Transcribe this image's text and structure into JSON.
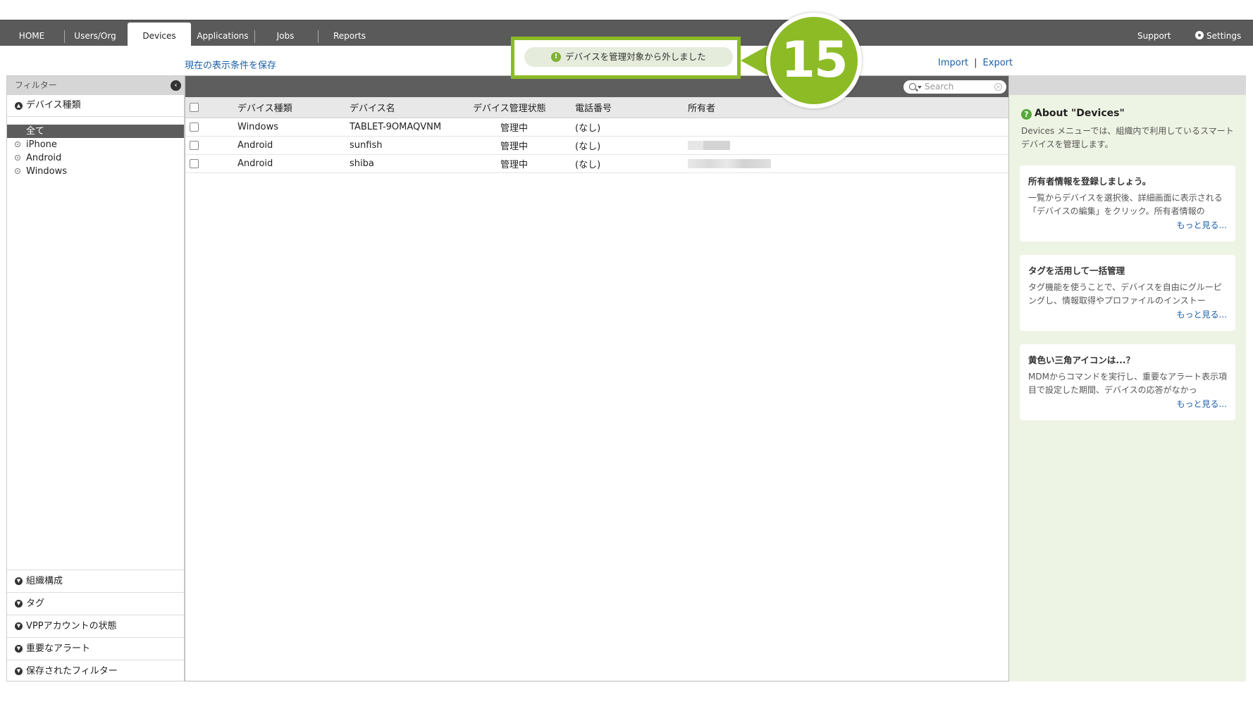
{
  "nav": {
    "tabs": [
      "HOME",
      "Users/Org",
      "Devices",
      "Applications",
      "Jobs",
      "Reports"
    ],
    "active_tab": "Devices",
    "support": "Support",
    "settings": "Settings"
  },
  "toolbar": {
    "save_view": "現在の表示条件を保存",
    "import": "Import",
    "separator": "|",
    "export": "Export"
  },
  "notification": {
    "message": "デバイスを管理対象から外しました",
    "callout_number": "15",
    "accent_color": "#8cbb26"
  },
  "filter": {
    "title": "フィルター",
    "device_type_header": "デバイス種類",
    "items": [
      "全て",
      "iPhone",
      "Android",
      "Windows"
    ],
    "selected": "全て",
    "sections": [
      "組織構成",
      "タグ",
      "VPPアカウントの状態",
      "重要なアラート",
      "保存されたフィルター"
    ]
  },
  "search": {
    "placeholder": "Search"
  },
  "table": {
    "columns": [
      "デバイス種類",
      "デバイス名",
      "デバイス管理状態",
      "電話番号",
      "所有者"
    ],
    "rows": [
      {
        "type": "Windows",
        "name": "TABLET-9OMAQVNM",
        "status": "管理中",
        "phone": "(なし)",
        "owner": ""
      },
      {
        "type": "Android",
        "name": "sunfish",
        "status": "管理中",
        "phone": "(なし)",
        "owner": ""
      },
      {
        "type": "Android",
        "name": "shiba",
        "status": "管理中",
        "phone": "(なし)",
        "owner": ""
      }
    ]
  },
  "info": {
    "title": "About \"Devices\"",
    "description": "Devices メニューでは、組織内で利用しているスマートデバイスを管理します。",
    "tips": [
      {
        "title": "所有者情報を登録しましょう。",
        "body": "一覧からデバイスを選択後、詳細画面に表示される「デバイスの編集」をクリック。所有者情報の",
        "more": "もっと見る..."
      },
      {
        "title": "タグを活用して一括管理",
        "body": "タグ機能を使うことで、デバイスを自由にグルーピングし、情報取得やプロファイルのインストー",
        "more": "もっと見る..."
      },
      {
        "title": "黄色い三角アイコンは...？",
        "body": "MDMからコマンドを実行し、重要なアラート表示項目で設定した期間、デバイスの応答がなかっ",
        "more": "もっと見る..."
      }
    ]
  }
}
